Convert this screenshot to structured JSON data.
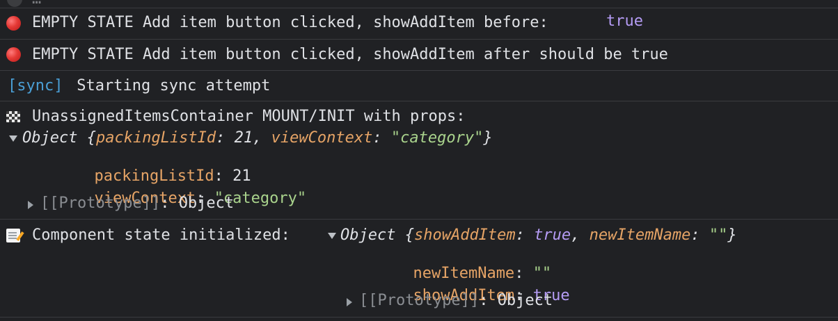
{
  "console": {
    "top_partial": "…",
    "messages": {
      "m1": {
        "icon": "red-circle-icon",
        "text": "EMPTY STATE Add item button clicked, showAddItem before: ",
        "value": "true"
      },
      "m2": {
        "icon": "red-circle-icon",
        "text": "EMPTY STATE Add item button clicked, showAddItem after should be true"
      },
      "m3": {
        "tag": "[sync]",
        "text": " Starting sync attempt"
      },
      "m4": {
        "icon": "checkered-flag-icon",
        "text": "UnassignedItemsContainer MOUNT/INIT with props:",
        "summary": {
          "prefix": "Object {",
          "k1": "packingListId",
          "sep1": ": ",
          "v1": "21",
          "comma": ", ",
          "k2": "viewContext",
          "sep2": ": ",
          "v2": "\"category\"",
          "suffix": "}"
        },
        "props": {
          "p1_key": "packingListId",
          "p1_sep": ": ",
          "p1_val": "21",
          "p2_key": "viewContext",
          "p2_sep": ": ",
          "p2_val": "\"category\"",
          "proto_label": "[[Prototype]]",
          "proto_sep": ": ",
          "proto_val": "Object"
        }
      },
      "m5": {
        "icon": "memo-icon",
        "text": "Component state initialized: ",
        "summary": {
          "prefix": "Object {",
          "k1": "showAddItem",
          "sep1": ": ",
          "v1": "true",
          "comma": ", ",
          "k2": "newItemName",
          "sep2": ": ",
          "v2": "\"\"",
          "suffix": "}"
        },
        "props": {
          "p1_key": "newItemName",
          "p1_sep": ": ",
          "p1_val": "\"\"",
          "p2_key": "showAddItem",
          "p2_sep": ": ",
          "p2_val": "true",
          "proto_label": "[[Prototype]]",
          "proto_sep": ": ",
          "proto_val": "Object"
        }
      }
    }
  }
}
